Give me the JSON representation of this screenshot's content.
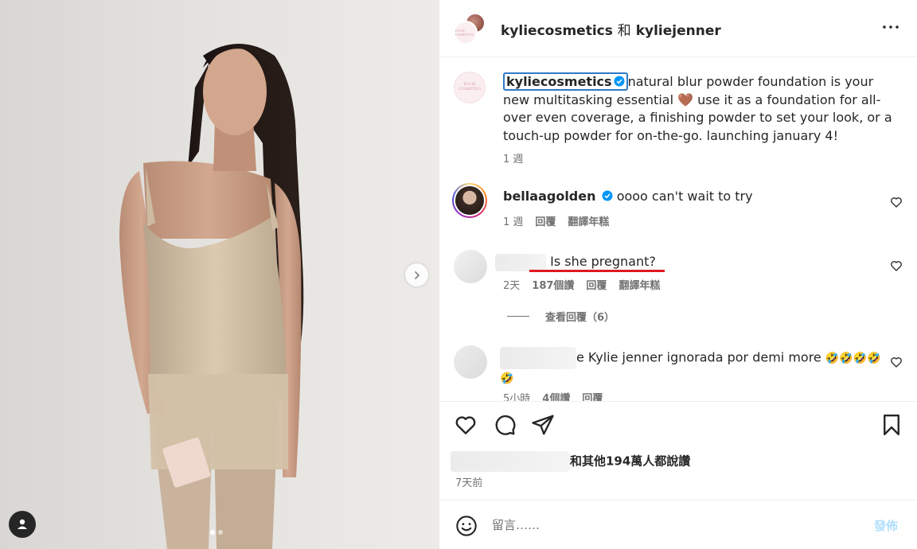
{
  "header": {
    "account_primary": "kyliecosmetics",
    "joiner": "和",
    "account_secondary": "kyliejenner",
    "avatar_text": "KYLIE COSMETICS"
  },
  "caption": {
    "username": "kyliecosmetics",
    "text": "natural blur powder foundation is your new multitasking essential 🤎 use it as a foundation for all-over even coverage, a finishing powder to set your look, or a touch-up powder for on-the-go. launching january 4!",
    "time": "1 週"
  },
  "comments": [
    {
      "username": "bellaagolden",
      "verified": true,
      "text": "oooo can't wait to try",
      "time": "1 週",
      "reply_label": "回覆",
      "translate_label": "翻譯年糕"
    },
    {
      "username": "",
      "text": "Is she pregnant?",
      "time": "2天",
      "likes": "187個讚",
      "reply_label": "回覆",
      "translate_label": "翻譯年糕"
    },
    {
      "username": "",
      "text": "e Kylie jenner ignorada por demi more",
      "emojis": "🤣🤣🤣🤣",
      "emoji_wrap": "🤣",
      "time": "5小時",
      "likes": "4個讚",
      "reply_label": "回覆"
    }
  ],
  "view_replies": "查看回覆（6）",
  "likes_summary": "和其他194萬人都說讚",
  "post_time": "7天前",
  "composer": {
    "placeholder": "留言……",
    "post_label": "發佈"
  },
  "carousel": {
    "current": 1,
    "total": 2
  },
  "icons": {
    "more": "more-options-icon",
    "like": "heart-icon",
    "comment": "comment-icon",
    "share": "paper-plane-icon",
    "save": "bookmark-icon",
    "emoji": "emoji-icon",
    "next": "chevron-right-icon",
    "tag": "user-tag-icon",
    "verified": "verified-badge-icon"
  },
  "colors": {
    "verified_blue": "#0095f6",
    "highlight_box": "#2f79c6",
    "underline_red": "#e0191f",
    "post_disabled": "#b2dffc"
  }
}
